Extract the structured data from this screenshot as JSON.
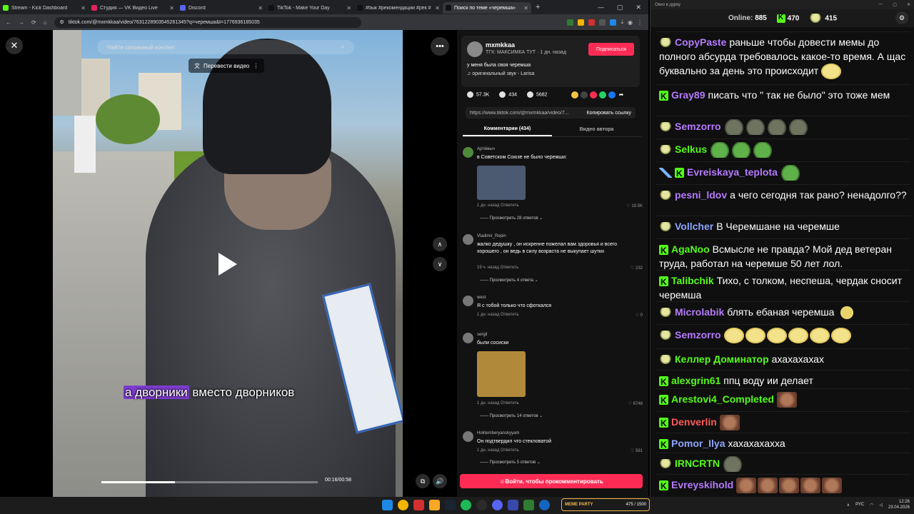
{
  "browser": {
    "tabs": [
      {
        "title": "Stream - Kick Dashboard",
        "color": "#53fc18",
        "active": false
      },
      {
        "title": "Студия — VK Видео Live",
        "color": "#e0245e",
        "active": false
      },
      {
        "title": "Discord",
        "color": "#5865f2",
        "active": false
      },
      {
        "title": "TikTok - Make Your Day",
        "color": "#111111",
        "active": false
      },
      {
        "title": "#бык #рекомендации #рек #",
        "color": "#111111",
        "active": false
      },
      {
        "title": "Поиск по теме «черемша»",
        "color": "#111111",
        "active": true
      }
    ],
    "new_tab": "+",
    "url": "tiktok.com/@mxmkkaa/video/7631228903545261345?q=черемша&t=1776936185035"
  },
  "video": {
    "search_placeholder": "Найти связанный контент",
    "translate_label": "Перевести видео",
    "subtitle_highlight": "а дворники",
    "subtitle_rest": " вместо дворников",
    "time": "00:16/00:58",
    "progress": 0.34
  },
  "post": {
    "username": "mxmkkaa",
    "meta": "ТГК: МАКСИМКА ТУТ · 1 дн. назад",
    "follow": "Подписаться",
    "caption": "у меня была своя черемша",
    "sound": "оригинальный звук - Larisa",
    "likes": "57.3K",
    "comments": "434",
    "saves": "5682",
    "link": "https://www.tiktok.com/@mxmkkaa/video/7...",
    "copy": "Копировать ссылку",
    "tab_comments": "Комментарии (434)",
    "tab_author": "Видео автора",
    "login": "Войти, чтобы прокомментировать"
  },
  "comments": [
    {
      "user": "Артёмыч",
      "text": "в Советском Союзе не было черемши:",
      "meta": "1 дн. назад   Ответить",
      "likes": "19.5K",
      "replies": "Просмотреть 28 ответов",
      "image": true,
      "img_color": "#4b5a70"
    },
    {
      "user": "Vladimir_Repin",
      "text": "жалко дедушку , он искренне пожелал вам здоровья и всего хорошего , он ведь в силу возраста не выкупает шутки",
      "meta": "19 ч. назад   Ответить",
      "likes": "232",
      "replies": "Просмотреть 4 ответа"
    },
    {
      "user": "west",
      "text": "Я с тобой только что сфоткался",
      "meta": "1 дн. назад   Ответить",
      "likes": "0"
    },
    {
      "user": "sergil",
      "text": "были сосиски",
      "meta": "1 дн. назад   Ответить",
      "likes": "6748",
      "replies": "Просмотреть 14 ответов",
      "image": true,
      "img_color": "#b08a3a"
    },
    {
      "user": "Hoktemberyanskyyam",
      "text": "Он подтвердил что стекловатой",
      "meta": "1 дн. назад   Ответить",
      "likes": "591",
      "replies": "Просмотреть 5 ответов"
    }
  ],
  "taskbar": {
    "meme_logo": "MEME PARTY",
    "meme_count": "475 / 1500",
    "lang": "РУС",
    "time": "12:26",
    "date": "23.04.2026"
  },
  "chat": {
    "window_title": "Окно в дурку",
    "online_label": "Online:",
    "online": "885",
    "kick_count": "470",
    "other_count": "415",
    "messages": [
      {
        "badges": [
          "h"
        ],
        "nick": "CopyPaste",
        "color": "#b57bff",
        "text": "раньше чтобы довести мемы до полного абсурда требовалось какое-то время. А щас буквально за день это происходит",
        "emotes": [
          "laugh"
        ]
      },
      {
        "badges": [
          "k"
        ],
        "nick": "Gray89",
        "color": "#b57bff",
        "text": "писать что \" так не было\" это тоже мем",
        "emotes": []
      },
      {
        "badges": [
          "h"
        ],
        "nick": "Semzorro",
        "color": "#b57bff",
        "text": "",
        "emotes": [
          "grey",
          "grey",
          "grey",
          "grey"
        ]
      },
      {
        "badges": [
          "h"
        ],
        "nick": "Selkus",
        "color": "#53fc18",
        "text": "",
        "emotes": [
          "pepe",
          "pepe",
          "pepe"
        ]
      },
      {
        "badges": [
          "sw",
          "k"
        ],
        "nick": "Evreiskaya_teplota",
        "color": "#b57bff",
        "text": "",
        "emotes": [
          "pepe"
        ]
      },
      {
        "badges": [
          "h"
        ],
        "nick": "pesni_ldov",
        "color": "#b57bff",
        "text": "а чего сегодня так рано? ненадолго??",
        "emotes": []
      },
      {
        "badges": [
          "h"
        ],
        "nick": "Vollcher",
        "color": "#8fa5ff",
        "text": "В Черемшане на черемше",
        "emotes": []
      },
      {
        "badges": [
          "k"
        ],
        "nick": "AgaNoo",
        "color": "#53fc18",
        "text": "Всмысле не правда? Мой дед ветеран труда, работал на черемше 50 лет лол.",
        "emotes": []
      },
      {
        "badges": [
          "k"
        ],
        "nick": "Talibchik",
        "color": "#53fc18",
        "text": "Тихо, с толком, неспеша, чердак сносит черемша",
        "emotes": []
      },
      {
        "badges": [
          "h"
        ],
        "nick": "Microlabik",
        "color": "#b57bff",
        "text": "блять ебаная черемша",
        "emotes": [
          "moji"
        ]
      },
      {
        "badges": [
          "h"
        ],
        "nick": "Semzorro",
        "color": "#b57bff",
        "text": "",
        "emotes": [
          "laugh",
          "laugh",
          "laugh",
          "laugh",
          "laugh",
          "laugh"
        ]
      },
      {
        "badges": [
          "h"
        ],
        "nick": "Келлер Доминатор",
        "color": "#53fc18",
        "text": "ахахахахах",
        "emotes": []
      },
      {
        "badges": [
          "k"
        ],
        "nick": "alexgrin61",
        "color": "#53fc18",
        "text": "ппц воду ии делает",
        "emotes": []
      },
      {
        "badges": [
          "k"
        ],
        "nick": "Arestovi4_Completed",
        "color": "#53fc18",
        "text": "",
        "emotes": [
          "face"
        ]
      },
      {
        "badges": [
          "k"
        ],
        "nick": "Denverlin",
        "color": "#ff5a5a",
        "text": "",
        "emotes": [
          "face"
        ]
      },
      {
        "badges": [
          "k"
        ],
        "nick": "Pomor_Ilya",
        "color": "#8fa5ff",
        "text": "хахахахахха",
        "emotes": []
      },
      {
        "badges": [
          "h"
        ],
        "nick": "IRNCRTN",
        "color": "#53fc18",
        "text": "",
        "emotes": [
          "grey"
        ]
      },
      {
        "badges": [
          "k"
        ],
        "nick": "Evreyskihold",
        "color": "#b57bff",
        "text": "",
        "emotes": [
          "face",
          "face",
          "face",
          "face",
          "face"
        ]
      }
    ]
  }
}
